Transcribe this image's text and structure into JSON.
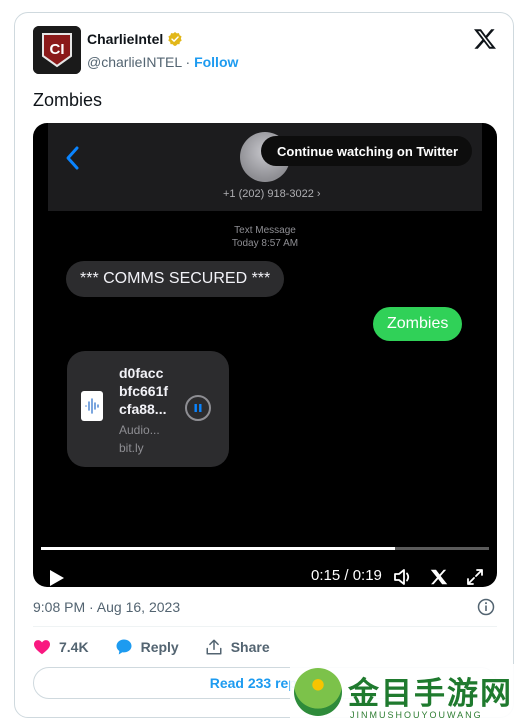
{
  "tweet": {
    "author_name": "CharlieIntel",
    "handle": "@charlieINTEL",
    "separator": "·",
    "follow_label": "Follow",
    "text": "Zombies",
    "timestamp": "9:08 PM · Aug 16, 2023",
    "likes": "7.4K",
    "reply_label": "Reply",
    "share_label": "Share",
    "read_replies": "Read 233 replies"
  },
  "video": {
    "continue_label": "Continue watching on Twitter",
    "time": "0:15 / 0:19",
    "progress": 0.79,
    "sms": {
      "contact_number": "+1 (202) 918-3022 ›",
      "meta_line1": "Text Message",
      "meta_line2": "Today 8:57 AM",
      "incoming_message": "*** COMMS SECURED ***",
      "outgoing_message": "Zombies",
      "audio_title_1": "d0facc",
      "audio_title_2": "bfc661f",
      "audio_title_3": "cfa88...",
      "audio_type": "Audio...",
      "audio_domain": "bit.ly"
    }
  },
  "watermark": {
    "text": "金目手游网",
    "sub": "JINMUSHOUYOUWANG"
  },
  "colors": {
    "accent": "#1d9bf0",
    "like": "#f91880",
    "imessage_green": "#30d158",
    "verified_gold": "#e2b719"
  },
  "icons": [
    "verified-badge-icon",
    "x-logo-icon",
    "chevron-left-icon",
    "pause-icon",
    "play-icon",
    "volume-icon",
    "x-icon",
    "expand-icon",
    "info-icon",
    "heart-icon",
    "reply-bubble-icon",
    "share-icon"
  ]
}
